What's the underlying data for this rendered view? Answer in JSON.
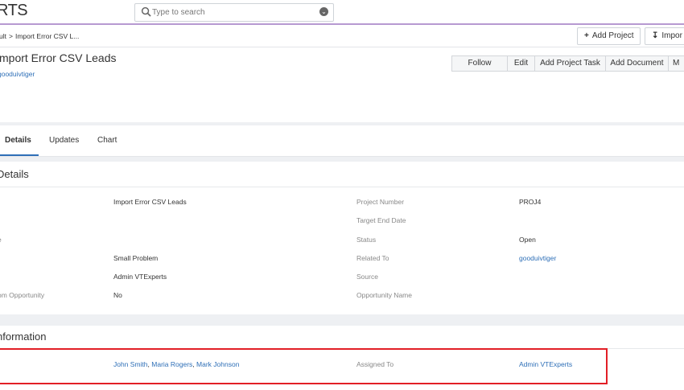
{
  "app": {
    "logo_text": "RTS"
  },
  "search": {
    "placeholder": "Type to search"
  },
  "breadcrumb": {
    "first": "ult",
    "separator": ">",
    "current": "Import Error CSV L..."
  },
  "header_buttons": {
    "add_project": "Add Project",
    "import": "Impor"
  },
  "record": {
    "title": "mport Error CSV Leads",
    "subtitle": "gooduivtiger"
  },
  "actions": {
    "follow": "Follow",
    "edit": "Edit",
    "add_project_task": "Add Project Task",
    "add_document": "Add Document",
    "more": "M"
  },
  "tabs": [
    "Details",
    "Updates",
    "Chart"
  ],
  "details": {
    "title": "Details",
    "left_rows": [
      {
        "label": "",
        "value": "Import Error CSV Leads"
      },
      {
        "label": "",
        "value": ""
      },
      {
        "label": "e",
        "value": ""
      },
      {
        "label": "",
        "value": "Small Problem"
      },
      {
        "label": "",
        "value": "Admin VTExperts"
      },
      {
        "label": "om Opportunity",
        "value": "No"
      }
    ],
    "right_rows": [
      {
        "label": "Project Number",
        "value": "PROJ4"
      },
      {
        "label": "Target End Date",
        "value": ""
      },
      {
        "label": "Status",
        "value": "Open"
      },
      {
        "label": "Related To",
        "value": "gooduivtiger"
      },
      {
        "label": "Source",
        "value": ""
      },
      {
        "label": "Opportunity Name",
        "value": ""
      }
    ]
  },
  "information": {
    "title": "nformation",
    "contacts": [
      "John Smith",
      "Maria Rogers",
      "Mark Johnson"
    ],
    "contacts_sep": ", ",
    "assigned_label": "Assigned To",
    "assigned_value": "Admin VTExperts"
  },
  "colors": {
    "accent": "#2e6fb7",
    "highlight": "#e21f26",
    "topbar_border": "#b79ad1"
  }
}
